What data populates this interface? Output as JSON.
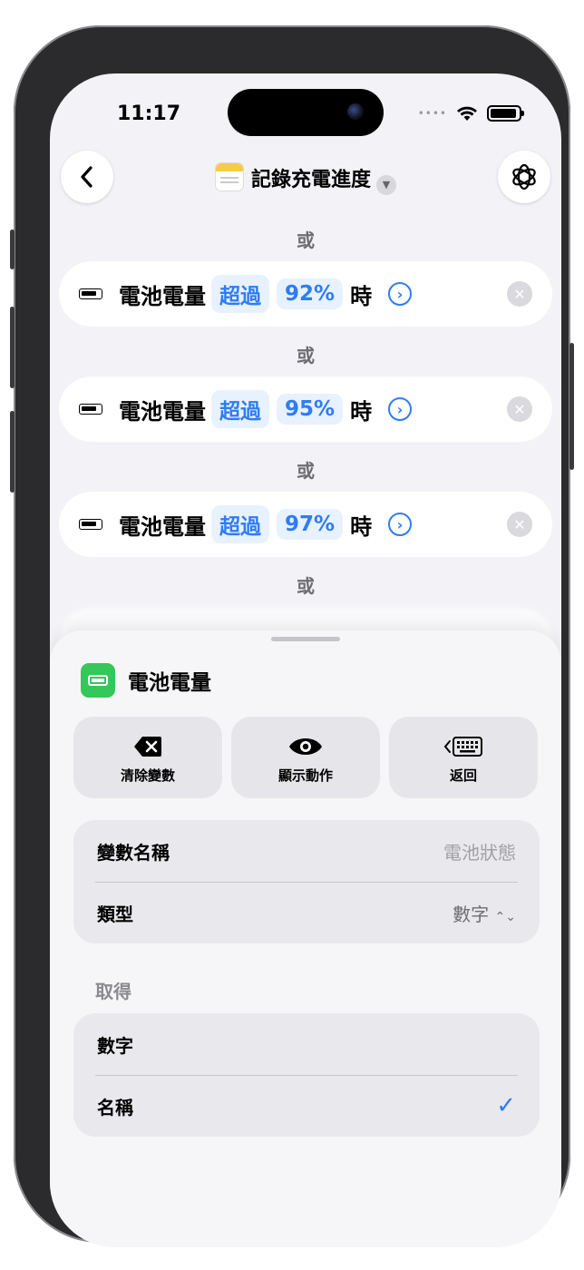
{
  "status_bar": {
    "time": "11:17"
  },
  "nav": {
    "title": "記錄充電進度",
    "back_icon": "chevron-left-icon",
    "settings_icon": "gear-icon"
  },
  "conditions": [
    {
      "separator": "或",
      "label": "電池電量",
      "op": "超過",
      "value": "92%",
      "suffix": "時"
    },
    {
      "separator": "或",
      "label": "電池電量",
      "op": "超過",
      "value": "95%",
      "suffix": "時"
    },
    {
      "separator": "或",
      "label": "電池電量",
      "op": "超過",
      "value": "97%",
      "suffix": "時"
    },
    {
      "separator": "或"
    }
  ],
  "sheet": {
    "title": "電池電量",
    "actions": [
      {
        "label": "清除變數",
        "icon": "delete-backward-icon"
      },
      {
        "label": "顯示動作",
        "icon": "eye-icon"
      },
      {
        "label": "返回",
        "icon": "keyboard-icon"
      }
    ],
    "fields": {
      "name_label": "變數名稱",
      "name_placeholder": "電池狀態",
      "type_label": "類型",
      "type_value": "數字"
    },
    "get_section": "取得",
    "options": [
      {
        "label": "數字",
        "selected": false
      },
      {
        "label": "名稱",
        "selected": true
      }
    ]
  },
  "colors": {
    "accent": "#2f7cf6",
    "battery_app": "#34c759"
  }
}
